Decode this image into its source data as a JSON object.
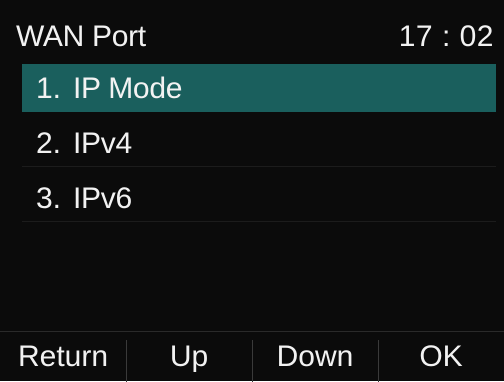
{
  "header": {
    "title": "WAN Port",
    "time": "17 : 02"
  },
  "menu": {
    "items": [
      {
        "number": "1.",
        "label": "IP Mode",
        "selected": true
      },
      {
        "number": "2.",
        "label": "IPv4",
        "selected": false
      },
      {
        "number": "3.",
        "label": "IPv6",
        "selected": false
      }
    ]
  },
  "softkeys": [
    {
      "label": "Return"
    },
    {
      "label": "Up"
    },
    {
      "label": "Down"
    },
    {
      "label": "OK"
    }
  ],
  "colors": {
    "background": "#0b0b0b",
    "highlight": "#1a5f5d",
    "text": "#f2f2f2"
  }
}
